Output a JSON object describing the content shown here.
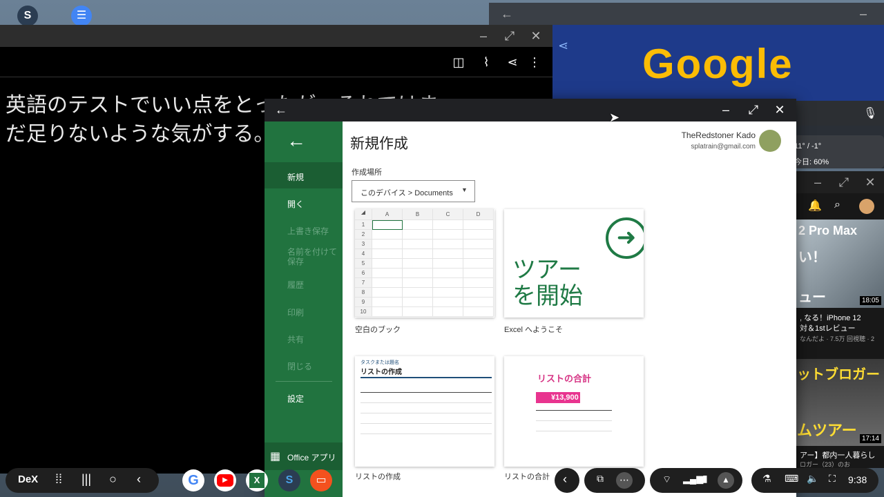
{
  "editor": {
    "text_line1": "英語のテストでいい点をとったが、それではま",
    "text_line2": "だ足りないような気がする。"
  },
  "google": {
    "doodle_text": "Google",
    "weather_temp": "11° / -1°",
    "weather_rain": "今日: 60%"
  },
  "youtube": {
    "thumb1_text": "2 Pro Max",
    "thumb1_sub": "い！",
    "thumb1_bottom": "ュー",
    "thumb1_duration": "18:05",
    "video1_title": ", なる！iPhone 12",
    "video1_title2": "対＆1stレビュー",
    "video1_meta": "なんだよ · 7.5万 回視聴 · 2",
    "thumb2_text": "ットブロガー",
    "thumb2_bottom": "ムツアー",
    "thumb2_duration": "17:14",
    "video2_title": "アー】都内一人暮らし",
    "video2_meta": "ロガー（23）のお"
  },
  "excel": {
    "page_title": "新規作成",
    "user_name": "TheRedstoner Kado",
    "user_email": "splatrain@gmail.com",
    "location_label": "作成場所",
    "location_value": "このデバイス > Documents",
    "sidebar": {
      "new": "新規",
      "open": "開く",
      "save": "上書き保存",
      "save_as": "名前を付けて保存",
      "history": "履歴",
      "print": "印刷",
      "share": "共有",
      "close": "閉じる",
      "settings": "設定",
      "office_apps": "Office アプリ"
    },
    "grid_columns": [
      "A",
      "B",
      "C",
      "D"
    ],
    "grid_rows": [
      "1",
      "2",
      "3",
      "4",
      "5",
      "6",
      "7",
      "8",
      "9",
      "10"
    ],
    "templates": {
      "blank": "空白のブック",
      "tour": "Excel へようこそ",
      "tour_text1": "ツアー",
      "tour_text2": "を開始",
      "list": "リストの作成",
      "list_subtitle": "タスクまたは題名",
      "list_heading": "リストの作成",
      "total": "リストの合計",
      "total_heading": "リストの合計",
      "total_amount": "¥13,900"
    }
  },
  "taskbar": {
    "dex_label": "DeX",
    "time": "9:38"
  },
  "colors": {
    "excel_green": "#21733f",
    "total_pink": "#e8348f"
  }
}
